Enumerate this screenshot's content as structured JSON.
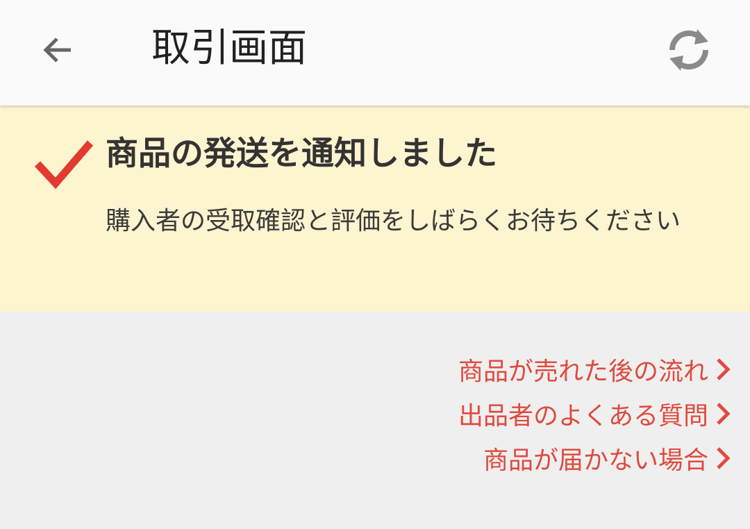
{
  "app_bar": {
    "title": "取引画面",
    "back_icon": "arrow-left-icon",
    "refresh_icon": "refresh-icon"
  },
  "notice": {
    "icon": "check-icon",
    "title": "商品の発送を通知しました",
    "message": "購入者の受取確認と評価をしばらくお待ちください",
    "accent_color": "#e23a2e",
    "background_color": "#fdf4d0"
  },
  "links": [
    {
      "label": "商品が売れた後の流れ"
    },
    {
      "label": "出品者のよくある質問"
    },
    {
      "label": "商品が届かない場合"
    }
  ],
  "colors": {
    "link": "#e04a3f",
    "icon_gray": "#8a8a8a",
    "page_background": "#efefef"
  }
}
